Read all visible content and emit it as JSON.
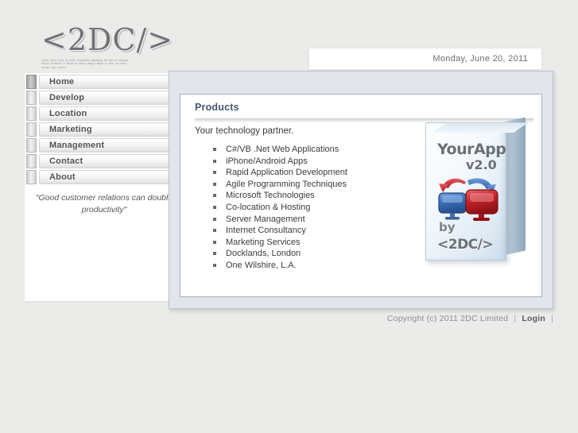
{
  "site": {
    "logo": "<2DC/>",
    "logo_tagline": "Lorem ipsum dolor sit amet consectetur adipiscing elit sed do eiusmod tempor incididunt ut labore et dolore magna aliqua ut enim ad minim veniam quis nostrud"
  },
  "nav": {
    "items": [
      {
        "label": "Home",
        "active": true
      },
      {
        "label": "Develop",
        "active": false
      },
      {
        "label": "Location",
        "active": false
      },
      {
        "label": "Marketing",
        "active": false
      },
      {
        "label": "Management",
        "active": false
      },
      {
        "label": "Contact",
        "active": false
      },
      {
        "label": "About",
        "active": false
      }
    ],
    "quote": "\"Good customer relations can double productivity\""
  },
  "header": {
    "date": "Monday, June 20, 2011"
  },
  "content": {
    "title": "Products",
    "subtitle": "Your technology partner.",
    "items": [
      "C#/VB .Net Web Applications",
      "iPhone/Android Apps",
      "Rapid Application Development",
      "Agile Programming Techniques",
      "Microsoft Technologies",
      "Co-location & Hosting",
      "Server Management",
      "Internet Consultancy",
      "Marketing Services",
      "Docklands, London",
      "One Wilshire, L.A."
    ]
  },
  "boxshot": {
    "title": "YourApp",
    "version": "v2.0",
    "by": "by",
    "brand": "<2DC/>",
    "icon_left_color": "#3b6fbb",
    "icon_right_color": "#c42026"
  },
  "footer": {
    "copyright": "Copyright (c) 2011 2DC Limited",
    "sep1": "|",
    "login": "Login",
    "sep2": "|"
  },
  "colors": {
    "page_background": "#ebebe9",
    "panel_background": "#e2e6ec",
    "panel_border": "#b9c0cb",
    "title_color": "#44566f"
  }
}
